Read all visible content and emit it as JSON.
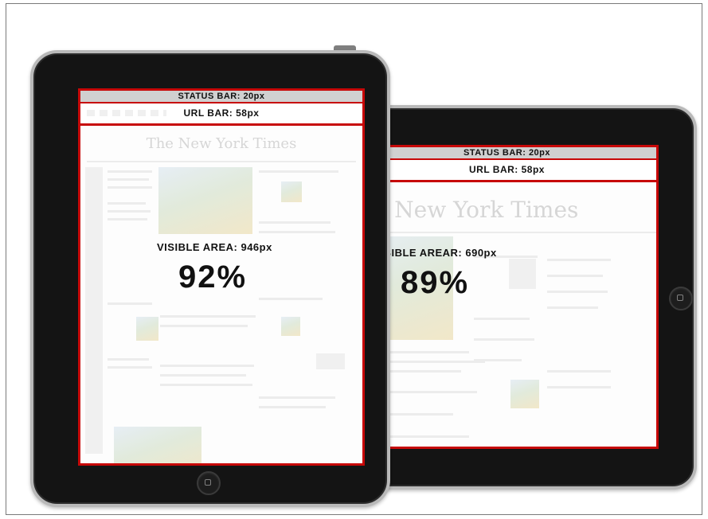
{
  "portrait": {
    "status_bar": "STATUS BAR: 20px",
    "url_bar": "URL BAR: 58px",
    "masthead": "The New York Times",
    "visible_area": "VISIBLE AREA: 946px",
    "percent": "92%"
  },
  "landscape": {
    "status_bar": "STATUS BAR: 20px",
    "url_bar": "URL BAR: 58px",
    "masthead": "The New York Times",
    "visible_area": "VISIBLE AREAR: 690px",
    "percent": "89%"
  },
  "colors": {
    "highlight_border": "#c70808",
    "device_body": "#141414",
    "device_rim": "#b9b9b9"
  },
  "icons": [
    "home-button-icon",
    "power-button-icon"
  ]
}
